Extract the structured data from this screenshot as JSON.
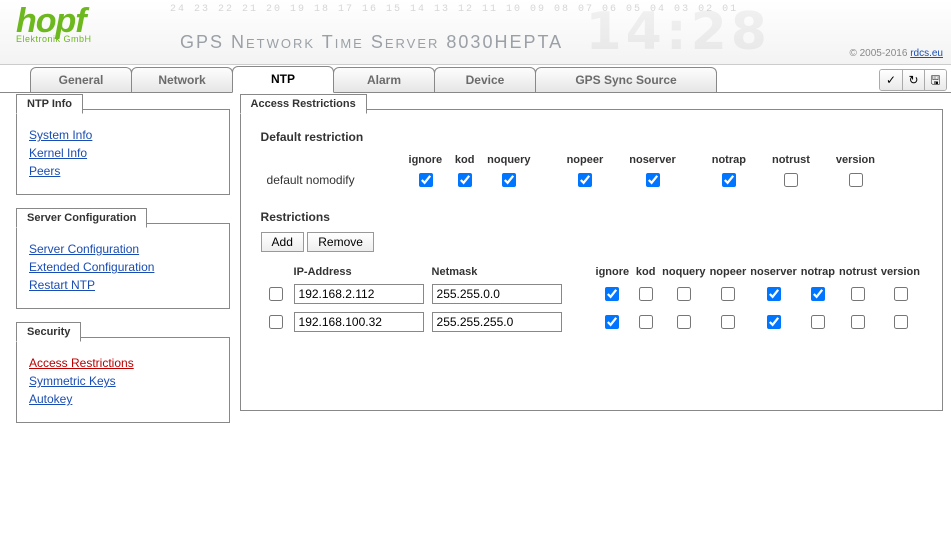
{
  "header": {
    "logo_main": "hopf",
    "logo_sub": "Elektronik GmbH",
    "faded_nums": "24 23 22 21 20 19 18 17 16 15 14 13 12 11 10 09 08 07 06 05 04 03 02 01",
    "title": "GPS Network Time Server 8030HEPTA",
    "bigclock": "14:28",
    "copyright_prefix": "© 2005-2016 ",
    "copyright_link": "rdcs.eu"
  },
  "tabs": [
    {
      "id": "general",
      "label": "General",
      "active": false
    },
    {
      "id": "network",
      "label": "Network",
      "active": false
    },
    {
      "id": "ntp",
      "label": "NTP",
      "active": true
    },
    {
      "id": "alarm",
      "label": "Alarm",
      "active": false
    },
    {
      "id": "device",
      "label": "Device",
      "active": false
    },
    {
      "id": "gpssync",
      "label": "GPS Sync Source",
      "active": false,
      "wide": true
    }
  ],
  "toolbar": {
    "apply_icon": "✓",
    "reload_icon": "↻",
    "save_icon": "🖫"
  },
  "sidebar": {
    "ntp_info": {
      "title": "NTP Info",
      "items": [
        {
          "id": "system-info",
          "label": "System Info"
        },
        {
          "id": "kernel-info",
          "label": "Kernel Info"
        },
        {
          "id": "peers",
          "label": "Peers"
        }
      ]
    },
    "server_cfg": {
      "title": "Server Configuration",
      "items": [
        {
          "id": "server-config",
          "label": "Server Configuration"
        },
        {
          "id": "ext-config",
          "label": "Extended Configuration"
        },
        {
          "id": "restart-ntp",
          "label": "Restart NTP"
        }
      ]
    },
    "security": {
      "title": "Security",
      "items": [
        {
          "id": "access-restrictions",
          "label": "Access Restrictions",
          "active": true
        },
        {
          "id": "symmetric-keys",
          "label": "Symmetric Keys"
        },
        {
          "id": "autokey",
          "label": "Autokey"
        }
      ]
    }
  },
  "content": {
    "panel_title": "Access Restrictions",
    "default_section_title": "Default restriction",
    "default_name": "default nomodify",
    "flags": [
      "ignore",
      "kod",
      "noquery",
      "nopeer",
      "noserver",
      "notrap",
      "notrust",
      "version"
    ],
    "default_flags": {
      "ignore": true,
      "kod": true,
      "noquery": true,
      "nopeer": true,
      "noserver": true,
      "notrap": true,
      "notrust": false,
      "version": false
    },
    "restrictions_section_title": "Restrictions",
    "buttons": {
      "add": "Add",
      "remove": "Remove"
    },
    "columns": {
      "ip": "IP-Address",
      "mask": "Netmask"
    },
    "rows": [
      {
        "selected": false,
        "ip": "192.168.2.112",
        "mask": "255.255.0.0",
        "flags": {
          "ignore": true,
          "kod": false,
          "noquery": false,
          "nopeer": false,
          "noserver": true,
          "notrap": true,
          "notrust": false,
          "version": false
        }
      },
      {
        "selected": false,
        "ip": "192.168.100.32",
        "mask": "255.255.255.0",
        "flags": {
          "ignore": true,
          "kod": false,
          "noquery": false,
          "nopeer": false,
          "noserver": true,
          "notrap": false,
          "notrust": false,
          "version": false
        }
      }
    ]
  }
}
